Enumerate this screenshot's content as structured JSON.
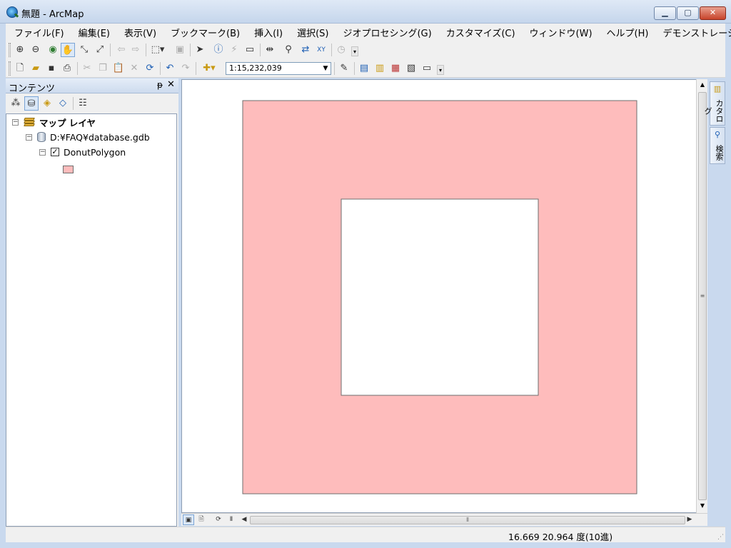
{
  "window": {
    "title": "無題 - ArcMap",
    "min_label": "▁",
    "max_label": "▢",
    "close_label": "✕"
  },
  "menu": [
    "ファイル(F)",
    "編集(E)",
    "表示(V)",
    "ブックマーク(B)",
    "挿入(I)",
    "選択(S)",
    "ジオプロセシング(G)",
    "カスタマイズ(C)",
    "ウィンドウ(W)",
    "ヘルプ(H)",
    "デモンストレーション"
  ],
  "toolbar": {
    "scale": "1:15,232,039",
    "icons": {
      "zoom_in": "zoom-in-icon",
      "zoom_out": "zoom-out-icon",
      "full_extent": "globe-icon",
      "pan": "pan-hand-icon",
      "identify": "info-icon",
      "find": "binoculars-icon",
      "go_to_xy": "xy-icon",
      "new": "new-document-icon",
      "open": "open-folder-icon",
      "save": "save-icon",
      "print": "print-icon",
      "undo": "undo-icon",
      "redo": "redo-icon",
      "add_data": "add-data-icon"
    }
  },
  "toc": {
    "title": "コンテンツ",
    "pin": "ᵽ",
    "close": "✕",
    "layers_root": "マップ レイヤ",
    "database": "D:¥FAQ¥database.gdb",
    "layer": "DonutPolygon",
    "layer_checked": true,
    "symbol_color": "#febcbc"
  },
  "map": {
    "fill": "#febcbc",
    "stroke": "#6e6e6e",
    "hole_fill": "#ffffff"
  },
  "right_dock": {
    "catalog": "カタログ",
    "search": "検索"
  },
  "status": {
    "coordinates": "16.669  20.964 度(10進)"
  }
}
